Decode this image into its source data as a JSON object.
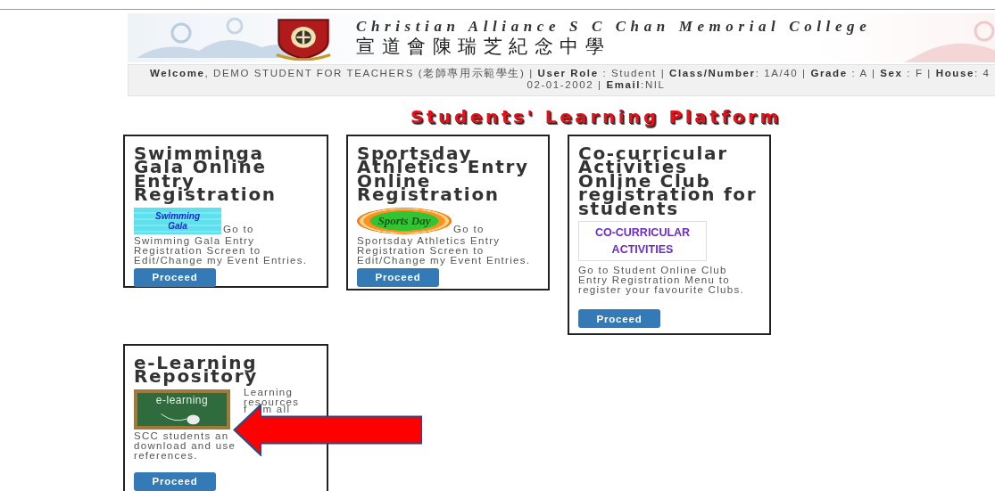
{
  "header": {
    "school_name_en": "Christian Alliance S C Chan Memorial College",
    "school_name_zh": "宣道會陳瑞芝紀念中學",
    "info_lines": [
      "**Welcome**, DEMO STUDENT FOR TEACHERS (老師專用示範學生) | **User Role** : Student | **Class/Number**: 1A/40 | **Grade** : A | **Sex** : F | **House**: 4",
      "02-01-2002 | **Email**:NIL"
    ]
  },
  "page_title": "Students' Learning Platform",
  "cards": [
    {
      "title": "Swimminga\nGala Online\nEntry\nRegistration",
      "image": {
        "kind": "swimming",
        "lines": [
          "Swimming",
          "Gala"
        ]
      },
      "lead": "Go to",
      "description": "Swimming Gala Entry\nRegistration Screen to\nEdit/Change my Event Entries.",
      "button": "Proceed"
    },
    {
      "title": "Sportsday\nAthletics Entry\nOnline\nRegistration",
      "image": {
        "kind": "sports",
        "lines": [
          "Sports Day"
        ]
      },
      "lead": "Go to",
      "description": "Sportsday Athletics Entry\nRegistration Screen to\nEdit/Change my Event Entries.",
      "button": "Proceed"
    },
    {
      "title": "Co-curricular\nActivities\nOnline Club\nregistration for\nstudents",
      "image": {
        "kind": "activities",
        "lines": [
          "CO-CURRICULAR",
          "ACTIVITIES"
        ]
      },
      "description": "Go to Student Online Club\nEntry Registration Menu to\nregister your favourite Clubs.",
      "button": "Proceed"
    },
    {
      "title": "e-Learning\nRepository",
      "image": {
        "kind": "chalkboard",
        "lines": [
          "e-learning"
        ]
      },
      "side_text": "Learning\nresources",
      "partial_texts": [
        "f",
        "m all"
      ],
      "description": "SCC students an\ndownload and use\nreferences.",
      "button": "Proceed"
    }
  ],
  "annotation": {
    "kind": "left-arrow"
  }
}
